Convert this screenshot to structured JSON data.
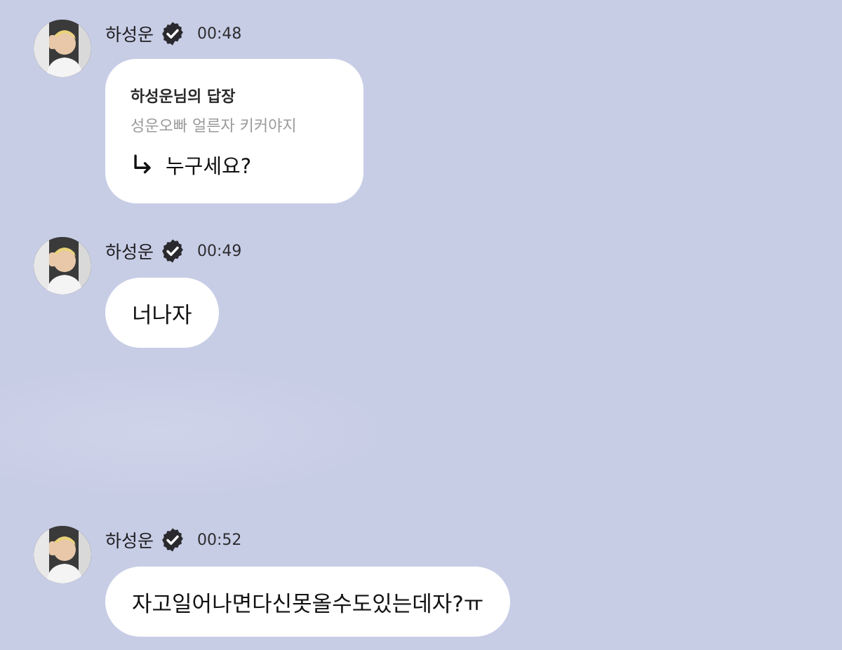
{
  "messages": [
    {
      "sender": "하성운",
      "time": "00:48",
      "reply_title": "하성운님의 답장",
      "reply_quote": "성운오빠 얼른자 키커야지",
      "reply_answer": "누구세요?"
    },
    {
      "sender": "하성운",
      "time": "00:49",
      "text": "너나자"
    },
    {
      "sender": "하성운",
      "time": "00:52",
      "text": "자고일어나면다신못올수도있는데자?ㅠ"
    }
  ],
  "colors": {
    "background": "#c8cde6",
    "bubble": "#ffffff",
    "verified_badge": "#2a2a2e"
  }
}
